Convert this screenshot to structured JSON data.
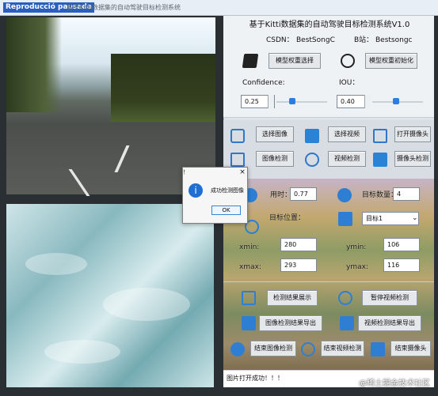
{
  "window": {
    "overlay_title": "Reproducció pausada",
    "title": "基于Kitti数据集的自动驾驶目标检测系统"
  },
  "header": {
    "title": "基于Kitti数据集的自动驾驶目标检测系统V1.0",
    "csdn_label": "CSDN：",
    "csdn_value": "BestSongC",
    "b_label": "B站：",
    "b_value": "Bestsongc"
  },
  "controls": {
    "model_select": "模型权重选择",
    "model_init": "模型权重初始化",
    "confidence_label": "Confidence:",
    "confidence_value": "0.25",
    "confidence_level": 0.25,
    "iou_label": "IOU：",
    "iou_value": "0.40",
    "iou_level": 0.4
  },
  "actions": {
    "select_image": "选择图像",
    "select_video": "选择视频",
    "open_camera": "打开摄像头",
    "detect_image": "图像检测",
    "detect_video": "视频检测",
    "detect_camera": "摄像头检测"
  },
  "results": {
    "time_label": "用时：",
    "time_value": "0.77",
    "count_label": "目标数量：",
    "count_value": "4",
    "position_label": "目标位置：",
    "target_value": "目标1",
    "xmin_label": "xmin:",
    "xmin_value": "280",
    "ymin_label": "ymin:",
    "ymin_value": "106",
    "xmax_label": "xmax:",
    "xmax_value": "293",
    "ymax_label": "ymax:",
    "ymax_value": "116"
  },
  "bottom": {
    "show_result": "检测结果展示",
    "pause_video": "暂停视频检测",
    "export_image": "图像检测结果导出",
    "export_video": "视频检测结果导出",
    "stop_image": "结束图像检测",
    "stop_video": "结束视频检测",
    "stop_camera": "结束摄像头"
  },
  "dialog": {
    "title": "！",
    "message": "成功检测图像",
    "ok": "OK",
    "close": "×"
  },
  "status": {
    "text": "图片打开成功！！！"
  },
  "watermark": "@稀土掘金技术社区"
}
